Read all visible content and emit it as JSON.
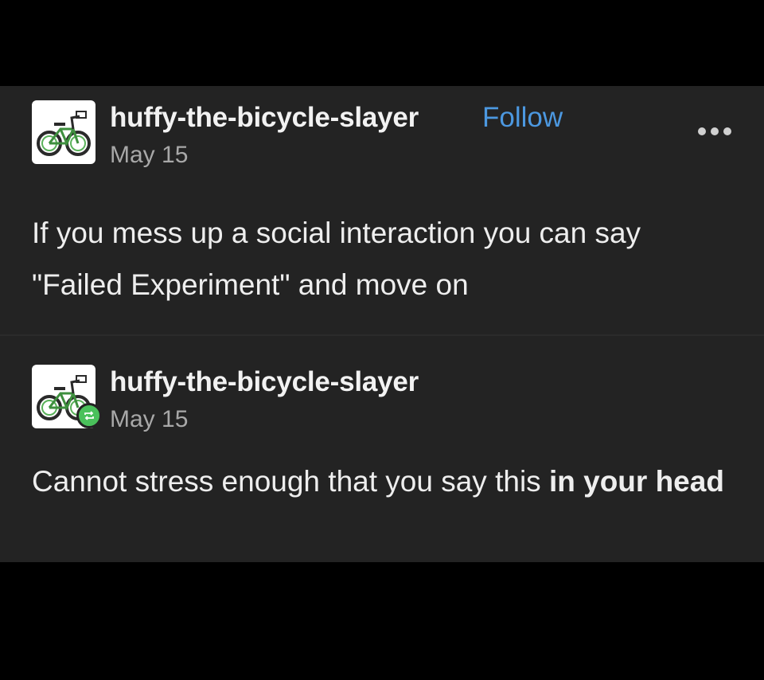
{
  "posts": [
    {
      "username": "huffy-the-bicycle-slayer",
      "follow_label": "Follow",
      "date": "May 15",
      "avatar_icon": "bicycle-icon",
      "body": "If you mess up a social interaction you can say \"Failed Experiment\" and move on"
    },
    {
      "username": "huffy-the-bicycle-slayer",
      "date": "May 15",
      "avatar_icon": "bicycle-icon",
      "badge_icon": "reblog-icon",
      "body_plain": "Cannot stress enough that you say this ",
      "body_bold": "in your head"
    }
  ],
  "more_icon": "more-options-icon",
  "colors": {
    "background": "#000000",
    "card": "#232323",
    "follow": "#4c98e0",
    "reblog_badge": "#4ac15b",
    "date": "#a8a8a8"
  }
}
